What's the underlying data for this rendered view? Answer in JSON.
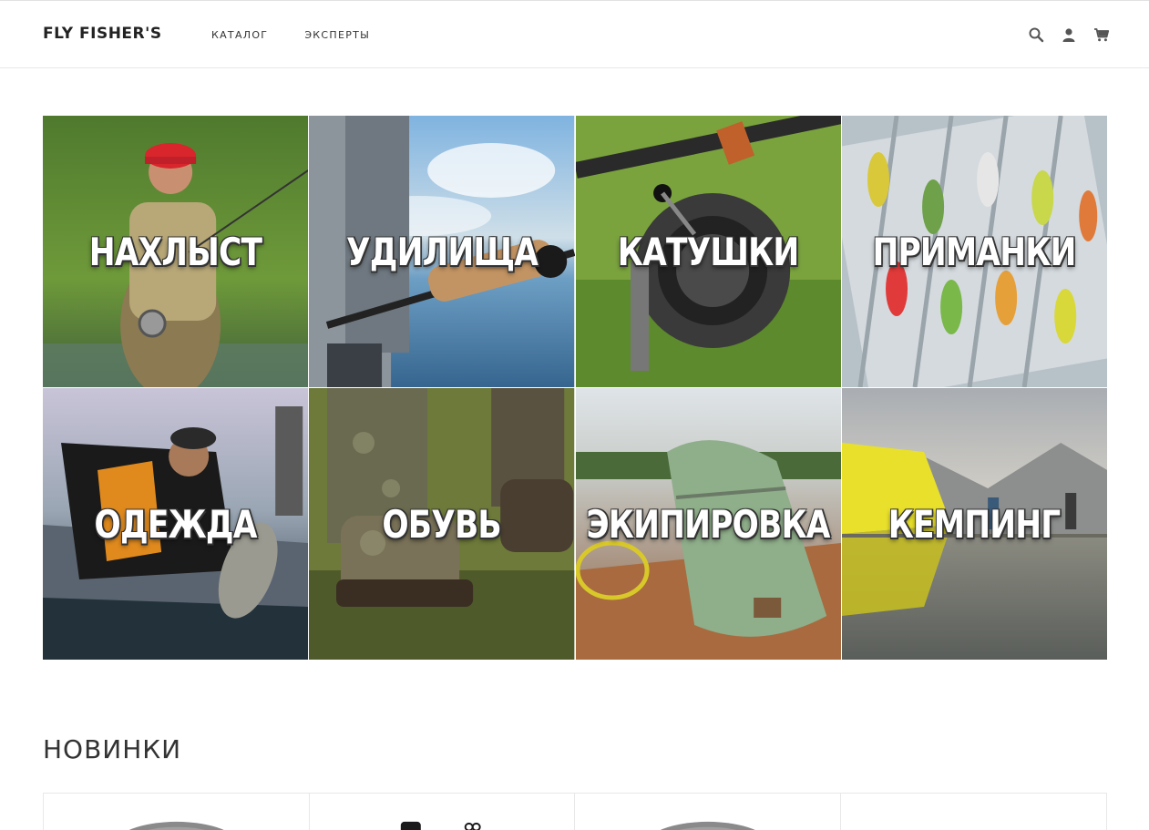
{
  "header": {
    "brand": "FLY FISHER'S",
    "nav": [
      {
        "label": "КАТАЛОГ"
      },
      {
        "label": "ЭКСПЕРТЫ"
      }
    ],
    "icons": [
      "search-icon",
      "user-icon",
      "cart-icon"
    ]
  },
  "categories": [
    {
      "label": "НАХЛЫСТ",
      "theme": "fly-fishing",
      "color": "#3f6b2e"
    },
    {
      "label": "УДИЛИЩА",
      "theme": "rods",
      "color": "#5f8fbf"
    },
    {
      "label": "КАТУШКИ",
      "theme": "reels",
      "color": "#5f8f3a"
    },
    {
      "label": "ПРИМАНКИ",
      "theme": "lures",
      "color": "#8a9aa6"
    },
    {
      "label": "ОДЕЖДА",
      "theme": "clothing",
      "color": "#6d7f93"
    },
    {
      "label": "ОБУВЬ",
      "theme": "footwear",
      "color": "#6f6a4a"
    },
    {
      "label": "ЭКИПИРОВКА",
      "theme": "equipment",
      "color": "#8d9a84"
    },
    {
      "label": "КЕМПИНГ",
      "theme": "camping",
      "color": "#a7a9a8"
    }
  ],
  "new_arrivals": {
    "title": "НОВИНКИ",
    "items": [
      {
        "image": "product-image-1"
      },
      {
        "image": "product-image-2"
      },
      {
        "image": "product-image-3"
      },
      {
        "image": "product-image-4"
      }
    ]
  }
}
